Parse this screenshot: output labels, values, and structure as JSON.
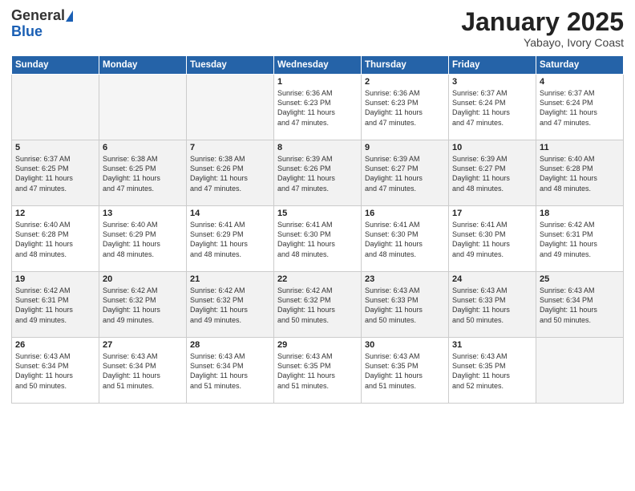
{
  "logo": {
    "general": "General",
    "blue": "Blue"
  },
  "header": {
    "month": "January 2025",
    "location": "Yabayo, Ivory Coast"
  },
  "days_of_week": [
    "Sunday",
    "Monday",
    "Tuesday",
    "Wednesday",
    "Thursday",
    "Friday",
    "Saturday"
  ],
  "weeks": [
    [
      {
        "day": "",
        "info": ""
      },
      {
        "day": "",
        "info": ""
      },
      {
        "day": "",
        "info": ""
      },
      {
        "day": "1",
        "info": "Sunrise: 6:36 AM\nSunset: 6:23 PM\nDaylight: 11 hours\nand 47 minutes."
      },
      {
        "day": "2",
        "info": "Sunrise: 6:36 AM\nSunset: 6:23 PM\nDaylight: 11 hours\nand 47 minutes."
      },
      {
        "day": "3",
        "info": "Sunrise: 6:37 AM\nSunset: 6:24 PM\nDaylight: 11 hours\nand 47 minutes."
      },
      {
        "day": "4",
        "info": "Sunrise: 6:37 AM\nSunset: 6:24 PM\nDaylight: 11 hours\nand 47 minutes."
      }
    ],
    [
      {
        "day": "5",
        "info": "Sunrise: 6:37 AM\nSunset: 6:25 PM\nDaylight: 11 hours\nand 47 minutes."
      },
      {
        "day": "6",
        "info": "Sunrise: 6:38 AM\nSunset: 6:25 PM\nDaylight: 11 hours\nand 47 minutes."
      },
      {
        "day": "7",
        "info": "Sunrise: 6:38 AM\nSunset: 6:26 PM\nDaylight: 11 hours\nand 47 minutes."
      },
      {
        "day": "8",
        "info": "Sunrise: 6:39 AM\nSunset: 6:26 PM\nDaylight: 11 hours\nand 47 minutes."
      },
      {
        "day": "9",
        "info": "Sunrise: 6:39 AM\nSunset: 6:27 PM\nDaylight: 11 hours\nand 47 minutes."
      },
      {
        "day": "10",
        "info": "Sunrise: 6:39 AM\nSunset: 6:27 PM\nDaylight: 11 hours\nand 48 minutes."
      },
      {
        "day": "11",
        "info": "Sunrise: 6:40 AM\nSunset: 6:28 PM\nDaylight: 11 hours\nand 48 minutes."
      }
    ],
    [
      {
        "day": "12",
        "info": "Sunrise: 6:40 AM\nSunset: 6:28 PM\nDaylight: 11 hours\nand 48 minutes."
      },
      {
        "day": "13",
        "info": "Sunrise: 6:40 AM\nSunset: 6:29 PM\nDaylight: 11 hours\nand 48 minutes."
      },
      {
        "day": "14",
        "info": "Sunrise: 6:41 AM\nSunset: 6:29 PM\nDaylight: 11 hours\nand 48 minutes."
      },
      {
        "day": "15",
        "info": "Sunrise: 6:41 AM\nSunset: 6:30 PM\nDaylight: 11 hours\nand 48 minutes."
      },
      {
        "day": "16",
        "info": "Sunrise: 6:41 AM\nSunset: 6:30 PM\nDaylight: 11 hours\nand 48 minutes."
      },
      {
        "day": "17",
        "info": "Sunrise: 6:41 AM\nSunset: 6:30 PM\nDaylight: 11 hours\nand 49 minutes."
      },
      {
        "day": "18",
        "info": "Sunrise: 6:42 AM\nSunset: 6:31 PM\nDaylight: 11 hours\nand 49 minutes."
      }
    ],
    [
      {
        "day": "19",
        "info": "Sunrise: 6:42 AM\nSunset: 6:31 PM\nDaylight: 11 hours\nand 49 minutes."
      },
      {
        "day": "20",
        "info": "Sunrise: 6:42 AM\nSunset: 6:32 PM\nDaylight: 11 hours\nand 49 minutes."
      },
      {
        "day": "21",
        "info": "Sunrise: 6:42 AM\nSunset: 6:32 PM\nDaylight: 11 hours\nand 49 minutes."
      },
      {
        "day": "22",
        "info": "Sunrise: 6:42 AM\nSunset: 6:32 PM\nDaylight: 11 hours\nand 50 minutes."
      },
      {
        "day": "23",
        "info": "Sunrise: 6:43 AM\nSunset: 6:33 PM\nDaylight: 11 hours\nand 50 minutes."
      },
      {
        "day": "24",
        "info": "Sunrise: 6:43 AM\nSunset: 6:33 PM\nDaylight: 11 hours\nand 50 minutes."
      },
      {
        "day": "25",
        "info": "Sunrise: 6:43 AM\nSunset: 6:34 PM\nDaylight: 11 hours\nand 50 minutes."
      }
    ],
    [
      {
        "day": "26",
        "info": "Sunrise: 6:43 AM\nSunset: 6:34 PM\nDaylight: 11 hours\nand 50 minutes."
      },
      {
        "day": "27",
        "info": "Sunrise: 6:43 AM\nSunset: 6:34 PM\nDaylight: 11 hours\nand 51 minutes."
      },
      {
        "day": "28",
        "info": "Sunrise: 6:43 AM\nSunset: 6:34 PM\nDaylight: 11 hours\nand 51 minutes."
      },
      {
        "day": "29",
        "info": "Sunrise: 6:43 AM\nSunset: 6:35 PM\nDaylight: 11 hours\nand 51 minutes."
      },
      {
        "day": "30",
        "info": "Sunrise: 6:43 AM\nSunset: 6:35 PM\nDaylight: 11 hours\nand 51 minutes."
      },
      {
        "day": "31",
        "info": "Sunrise: 6:43 AM\nSunset: 6:35 PM\nDaylight: 11 hours\nand 52 minutes."
      },
      {
        "day": "",
        "info": ""
      }
    ]
  ]
}
